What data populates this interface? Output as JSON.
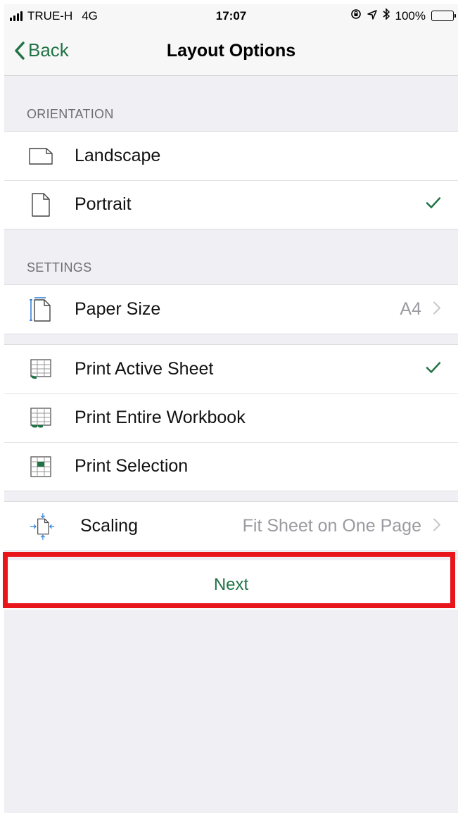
{
  "status_bar": {
    "carrier": "TRUE-H",
    "network": "4G",
    "time": "17:07",
    "battery": "100%",
    "icons": [
      "signal-icon",
      "rotation-lock-icon",
      "location-icon",
      "bluetooth-icon",
      "battery-icon"
    ]
  },
  "nav": {
    "back_label": "Back",
    "title": "Layout Options"
  },
  "orientation": {
    "header": "ORIENTATION",
    "items": [
      {
        "label": "Landscape",
        "icon": "landscape-page-icon",
        "selected": false
      },
      {
        "label": "Portrait",
        "icon": "portrait-page-icon",
        "selected": true
      }
    ]
  },
  "settings": {
    "header": "SETTINGS",
    "paper_size": {
      "label": "Paper Size",
      "value": "A4",
      "icon": "paper-size-icon"
    }
  },
  "print_scope": {
    "items": [
      {
        "label": "Print Active Sheet",
        "icon": "active-sheet-icon",
        "selected": true
      },
      {
        "label": "Print Entire Workbook",
        "icon": "entire-workbook-icon",
        "selected": false
      },
      {
        "label": "Print Selection",
        "icon": "selection-icon",
        "selected": false
      }
    ]
  },
  "scaling": {
    "label": "Scaling",
    "value": "Fit Sheet on One Page",
    "icon": "scaling-icon"
  },
  "next_label": "Next",
  "colors": {
    "accent": "#217346",
    "highlight": "#e8151b",
    "background": "#efeff4",
    "secondary_text": "#6d6d72"
  }
}
